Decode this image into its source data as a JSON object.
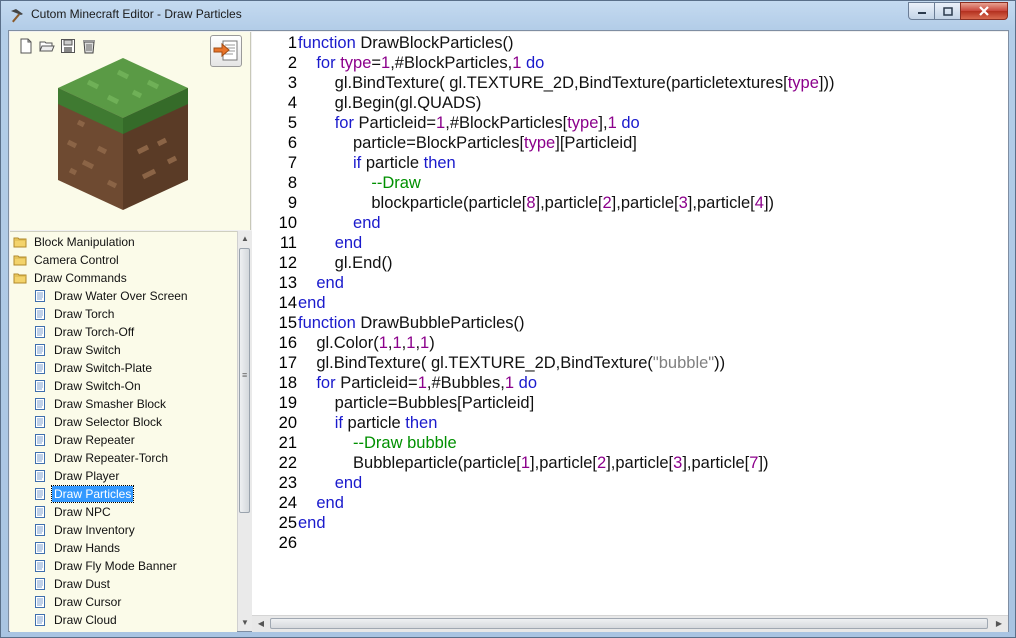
{
  "window": {
    "title": "Cutom Minecraft Editor - Draw Particles"
  },
  "caption_buttons": {
    "minimize_icon": "minimize-icon",
    "maximize_icon": "maximize-icon",
    "close_icon": "close-icon"
  },
  "toolbar": {
    "icons": [
      "new-file-icon",
      "open-folder-icon",
      "save-icon",
      "delete-icon"
    ],
    "export_icon": "export-icon"
  },
  "preview": {
    "image": "grass-block-icon",
    "colors": {
      "grass": "#4f8a3c",
      "dirt": "#6b4a33"
    }
  },
  "tree": {
    "items": [
      {
        "label": "Block Manipulation",
        "type": "folder",
        "level": 0
      },
      {
        "label": "Camera Control",
        "type": "folder",
        "level": 0
      },
      {
        "label": "Draw Commands",
        "type": "folder",
        "level": 0,
        "expanded": true
      },
      {
        "label": "Draw Water Over Screen",
        "type": "doc",
        "level": 1
      },
      {
        "label": "Draw Torch",
        "type": "doc",
        "level": 1
      },
      {
        "label": "Draw Torch-Off",
        "type": "doc",
        "level": 1
      },
      {
        "label": "Draw Switch",
        "type": "doc",
        "level": 1
      },
      {
        "label": "Draw Switch-Plate",
        "type": "doc",
        "level": 1
      },
      {
        "label": "Draw Switch-On",
        "type": "doc",
        "level": 1
      },
      {
        "label": "Draw Smasher Block",
        "type": "doc",
        "level": 1
      },
      {
        "label": "Draw Selector Block",
        "type": "doc",
        "level": 1
      },
      {
        "label": "Draw Repeater",
        "type": "doc",
        "level": 1
      },
      {
        "label": "Draw Repeater-Torch",
        "type": "doc",
        "level": 1
      },
      {
        "label": "Draw Player",
        "type": "doc",
        "level": 1
      },
      {
        "label": "Draw Particles",
        "type": "doc",
        "level": 1,
        "selected": true
      },
      {
        "label": "Draw NPC",
        "type": "doc",
        "level": 1
      },
      {
        "label": "Draw Inventory",
        "type": "doc",
        "level": 1
      },
      {
        "label": "Draw Hands",
        "type": "doc",
        "level": 1
      },
      {
        "label": "Draw Fly Mode Banner",
        "type": "doc",
        "level": 1
      },
      {
        "label": "Draw Dust",
        "type": "doc",
        "level": 1
      },
      {
        "label": "Draw Cursor",
        "type": "doc",
        "level": 1
      },
      {
        "label": "Draw Cloud",
        "type": "doc",
        "level": 1
      }
    ],
    "scroll": {
      "up_icon": "scroll-up-icon",
      "down_icon": "scroll-down-icon"
    }
  },
  "syntax_colors": {
    "keyword": "#1a1acc",
    "number": "#8b008b",
    "string": "#808080",
    "comment": "#009000"
  },
  "code": {
    "lines": [
      [
        [
          "k",
          "function"
        ],
        [
          "t",
          " DrawBlockParticles()"
        ]
      ],
      [
        [
          "t",
          "    "
        ],
        [
          "k",
          "for"
        ],
        [
          "t",
          " "
        ],
        [
          "n",
          "type"
        ],
        [
          "t",
          "="
        ],
        [
          "n",
          "1"
        ],
        [
          "t",
          ",#BlockParticles,"
        ],
        [
          "n",
          "1"
        ],
        [
          "t",
          " "
        ],
        [
          "k",
          "do"
        ]
      ],
      [
        [
          "t",
          "        gl.BindTexture( gl.TEXTURE_2D,BindTexture(particletextures["
        ],
        [
          "n",
          "type"
        ],
        [
          "t",
          "]))"
        ]
      ],
      [
        [
          "t",
          "        gl.Begin(gl.QUADS)"
        ]
      ],
      [
        [
          "t",
          "        "
        ],
        [
          "k",
          "for"
        ],
        [
          "t",
          " Particleid="
        ],
        [
          "n",
          "1"
        ],
        [
          "t",
          ",#BlockParticles["
        ],
        [
          "n",
          "type"
        ],
        [
          "t",
          "],"
        ],
        [
          "n",
          "1"
        ],
        [
          "t",
          " "
        ],
        [
          "k",
          "do"
        ]
      ],
      [
        [
          "t",
          "            particle=BlockParticles["
        ],
        [
          "n",
          "type"
        ],
        [
          "t",
          "][Particleid]"
        ]
      ],
      [
        [
          "t",
          "            "
        ],
        [
          "k",
          "if"
        ],
        [
          "t",
          " particle "
        ],
        [
          "k",
          "then"
        ]
      ],
      [
        [
          "t",
          "                "
        ],
        [
          "c",
          "--Draw"
        ]
      ],
      [
        [
          "t",
          "                blockparticle(particle["
        ],
        [
          "n",
          "8"
        ],
        [
          "t",
          "],particle["
        ],
        [
          "n",
          "2"
        ],
        [
          "t",
          "],particle["
        ],
        [
          "n",
          "3"
        ],
        [
          "t",
          "],particle["
        ],
        [
          "n",
          "4"
        ],
        [
          "t",
          "])"
        ]
      ],
      [
        [
          "t",
          "            "
        ],
        [
          "k",
          "end"
        ]
      ],
      [
        [
          "t",
          "        "
        ],
        [
          "k",
          "end"
        ]
      ],
      [
        [
          "t",
          "        gl.End()"
        ]
      ],
      [
        [
          "t",
          "    "
        ],
        [
          "k",
          "end"
        ]
      ],
      [
        [
          "k",
          "end"
        ]
      ],
      [
        [
          "k",
          "function"
        ],
        [
          "t",
          " DrawBubbleParticles()"
        ]
      ],
      [
        [
          "t",
          "    gl.Color("
        ],
        [
          "n",
          "1"
        ],
        [
          "t",
          ","
        ],
        [
          "n",
          "1"
        ],
        [
          "t",
          ","
        ],
        [
          "n",
          "1"
        ],
        [
          "t",
          ","
        ],
        [
          "n",
          "1"
        ],
        [
          "t",
          ")"
        ]
      ],
      [
        [
          "t",
          "    gl.BindTexture( gl.TEXTURE_2D,BindTexture("
        ],
        [
          "s",
          "\"bubble\""
        ],
        [
          "t",
          "))"
        ]
      ],
      [
        [
          "t",
          "    "
        ],
        [
          "k",
          "for"
        ],
        [
          "t",
          " Particleid="
        ],
        [
          "n",
          "1"
        ],
        [
          "t",
          ",#Bubbles,"
        ],
        [
          "n",
          "1"
        ],
        [
          "t",
          " "
        ],
        [
          "k",
          "do"
        ]
      ],
      [
        [
          "t",
          "        particle=Bubbles[Particleid]"
        ]
      ],
      [
        [
          "t",
          "        "
        ],
        [
          "k",
          "if"
        ],
        [
          "t",
          " particle "
        ],
        [
          "k",
          "then"
        ]
      ],
      [
        [
          "t",
          "            "
        ],
        [
          "c",
          "--Draw bubble"
        ]
      ],
      [
        [
          "t",
          "            Bubbleparticle(particle["
        ],
        [
          "n",
          "1"
        ],
        [
          "t",
          "],particle["
        ],
        [
          "n",
          "2"
        ],
        [
          "t",
          "],particle["
        ],
        [
          "n",
          "3"
        ],
        [
          "t",
          "],particle["
        ],
        [
          "n",
          "7"
        ],
        [
          "t",
          "])"
        ]
      ],
      [
        [
          "t",
          "        "
        ],
        [
          "k",
          "end"
        ]
      ],
      [
        [
          "t",
          "    "
        ],
        [
          "k",
          "end"
        ]
      ],
      [
        [
          "k",
          "end"
        ]
      ],
      []
    ]
  },
  "hscroll": {
    "left_icon": "scroll-left-icon",
    "right_icon": "scroll-right-icon"
  }
}
